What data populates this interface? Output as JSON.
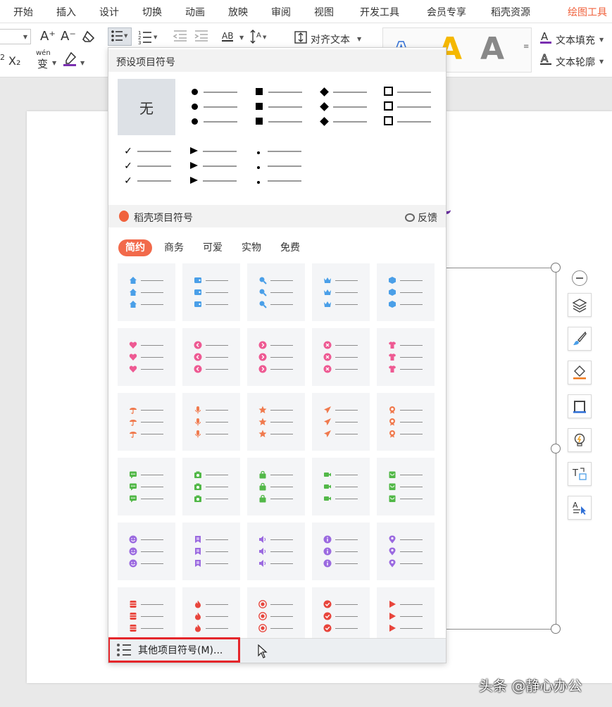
{
  "menu": {
    "items": [
      "开始",
      "插入",
      "设计",
      "切换",
      "动画",
      "放映",
      "审阅",
      "视图",
      "开发工具",
      "会员专享",
      "稻壳资源"
    ],
    "active_tab": "绘图工具"
  },
  "ribbon": {
    "text_fill": "文本填充",
    "text_outline": "文本轮廓",
    "align_text": "对齐文本",
    "phonetic": "wén",
    "phonetic_char": "变",
    "ab_label": "AB",
    "font_grow": "A⁺",
    "font_shrink": "A⁻",
    "subscript": "X₂",
    "superscript_frag": "2"
  },
  "panel": {
    "preset_title": "预设项目符号",
    "none_label": "无",
    "docer_title": "稻壳项目符号",
    "feedback": "反馈",
    "tabs": [
      "简约",
      "商务",
      "可爱",
      "实物",
      "免费"
    ],
    "active_tab": "简约",
    "footer_label": "其他项目符号(M)..."
  },
  "tile_colors": {
    "blue": "#4a9fe8",
    "pink": "#ee5a93",
    "orange": "#f07a4e",
    "green": "#52b848",
    "purple": "#9b6ae0",
    "red": "#e8453c"
  },
  "tile_icons": [
    [
      "house-icon",
      "wallet-icon",
      "magnifier-icon",
      "crown-icon",
      "cube-icon"
    ],
    [
      "heart-icon",
      "left-arrow-circle-icon",
      "right-arrow-circle-icon",
      "close-circle-icon",
      "tshirt-icon"
    ],
    [
      "umbrella-icon",
      "microphone-icon",
      "star-icon",
      "paper-plane-icon",
      "medal-icon"
    ],
    [
      "chat-bubble-icon",
      "camera-icon",
      "bag-icon",
      "video-icon",
      "cart-icon"
    ],
    [
      "smiley-icon",
      "bookmark-icon",
      "speaker-icon",
      "info-circle-icon",
      "location-pin-icon"
    ],
    [
      "database-icon",
      "flame-icon",
      "target-icon",
      "check-circle-icon",
      "play-icon"
    ]
  ],
  "watermark": "头条 @静心办公"
}
